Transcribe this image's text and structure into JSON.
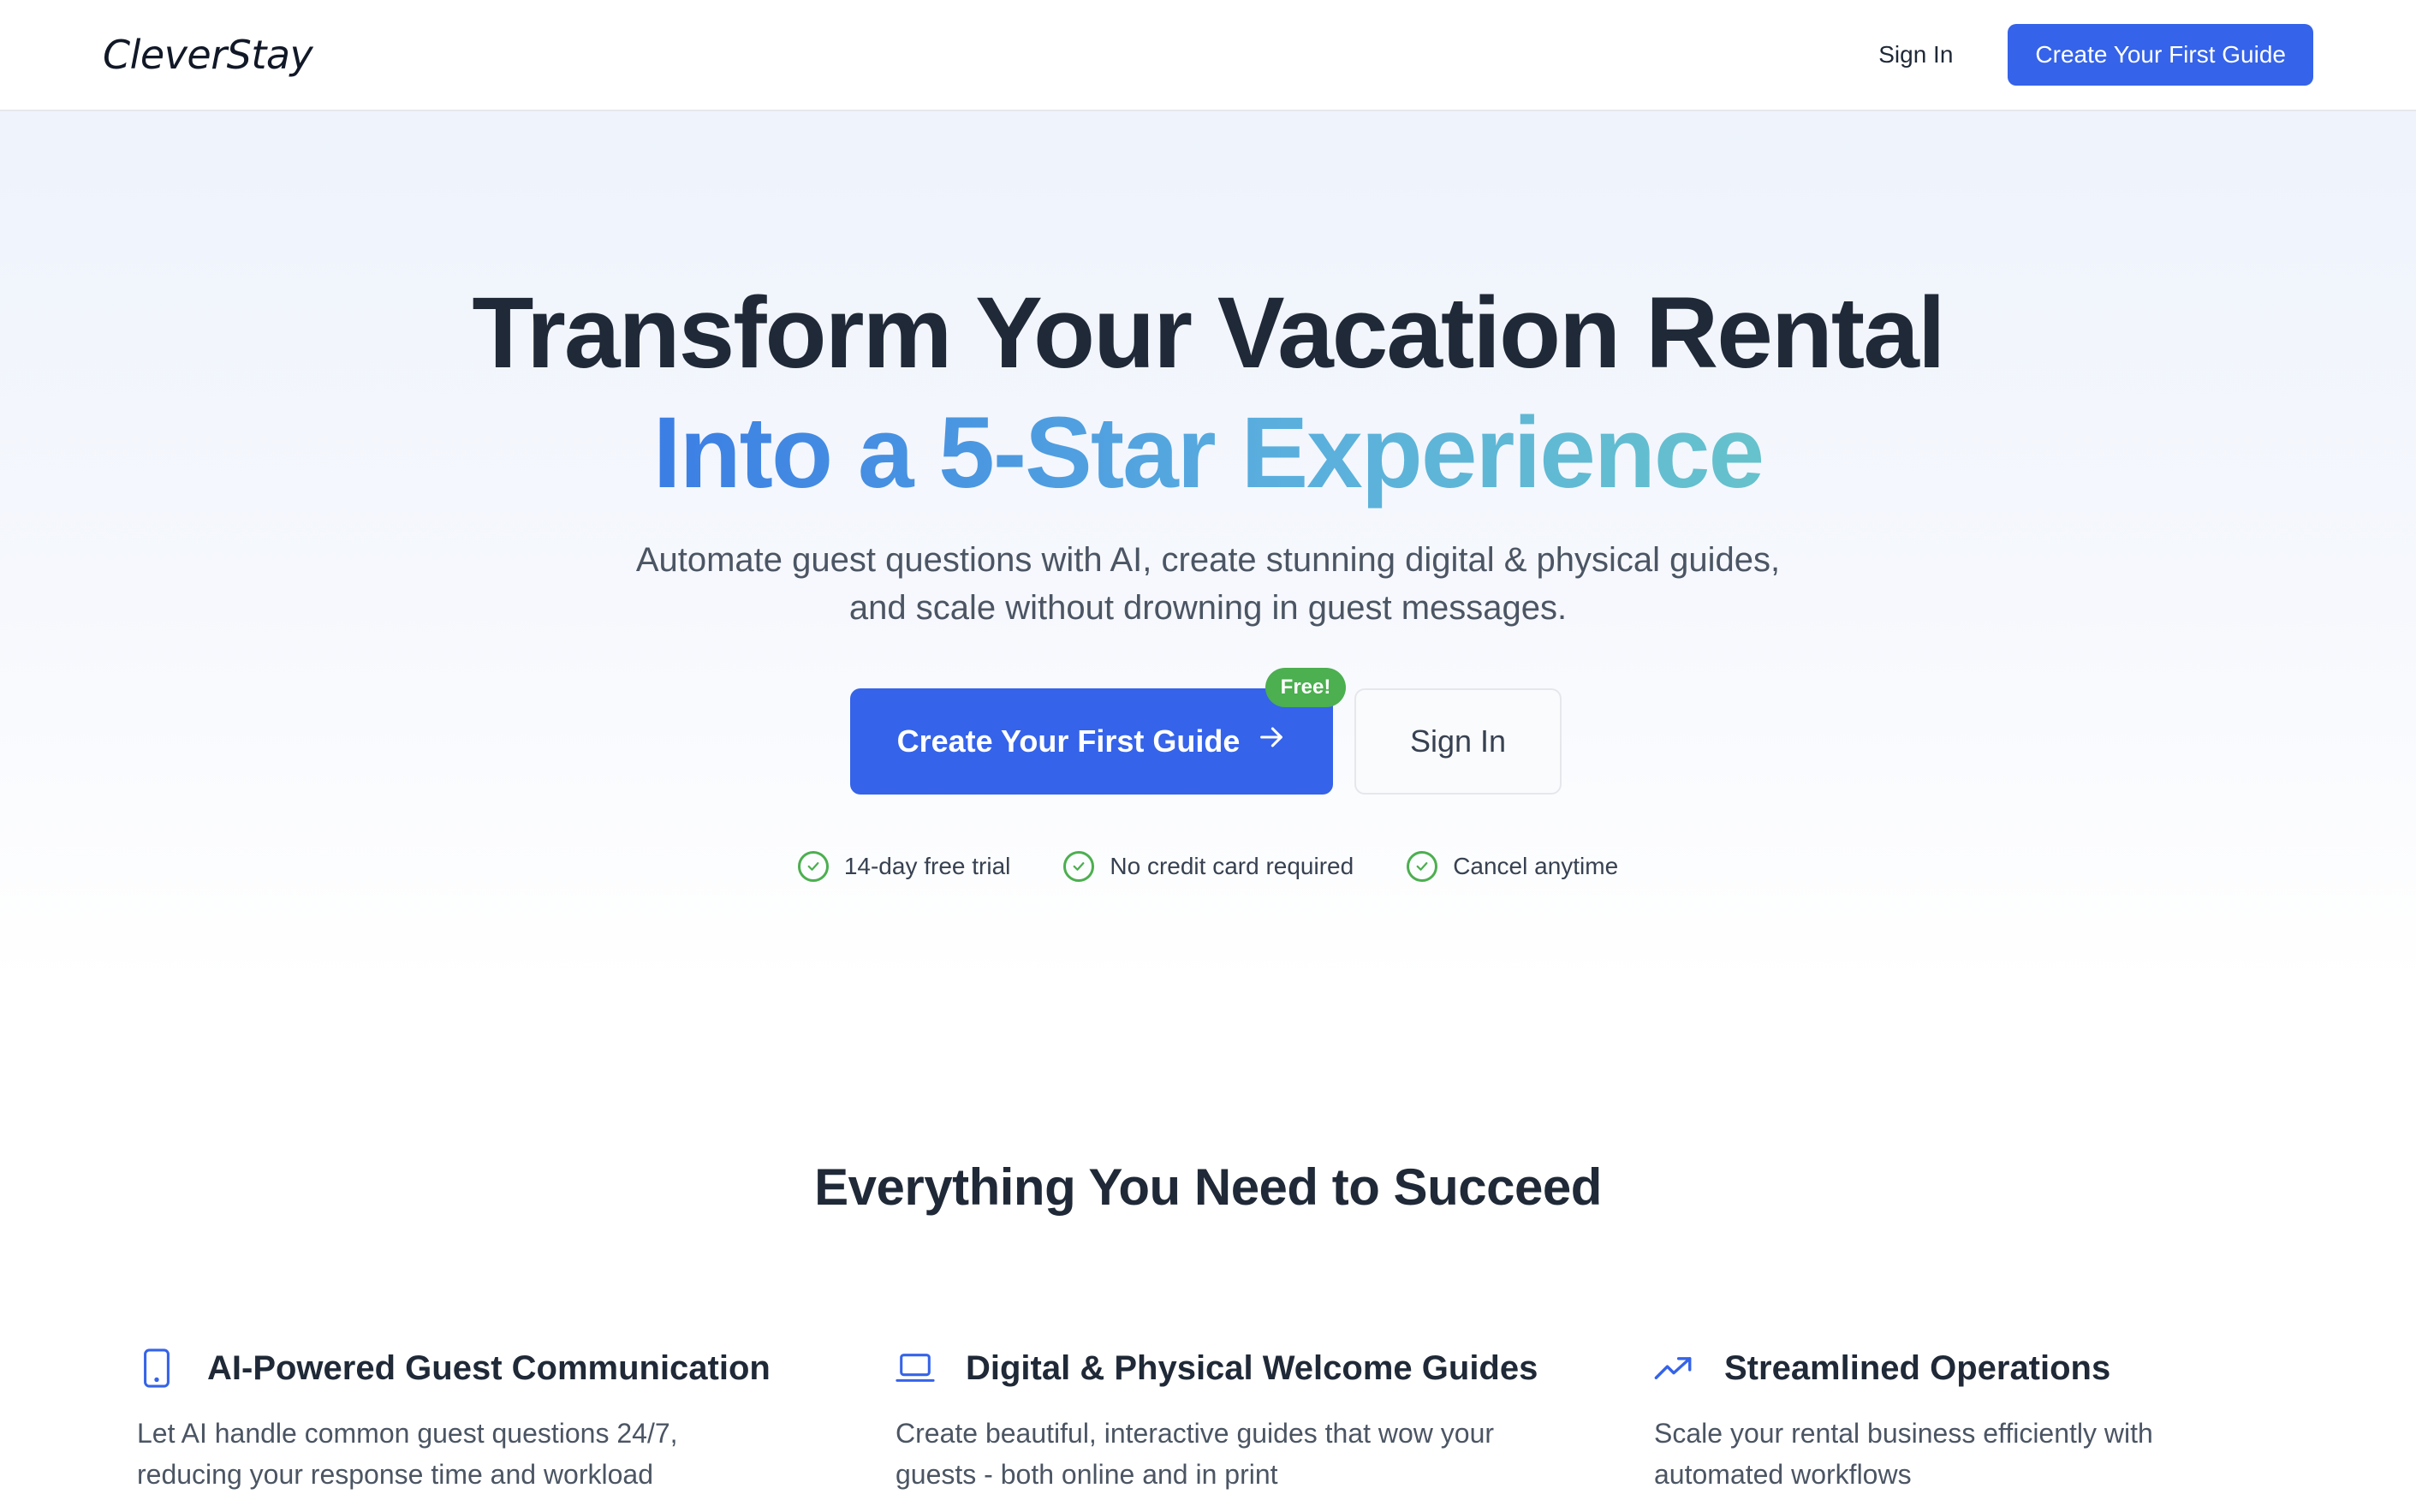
{
  "nav": {
    "logo": "CleverStay",
    "signin_label": "Sign In",
    "cta_label": "Create Your First Guide"
  },
  "hero": {
    "title_line1": "Transform Your Vacation Rental",
    "title_line2": "Into a 5-Star Experience",
    "subtitle_line1": "Automate guest questions with AI, create stunning digital & physical guides,",
    "subtitle_line2": "and scale without drowning in guest messages.",
    "primary_cta": "Create Your First Guide",
    "primary_cta_icon": "arrow-right-icon",
    "badge": "Free!",
    "secondary_cta": "Sign In",
    "checks": [
      {
        "label": "14-day free trial",
        "icon": "check-circle-icon"
      },
      {
        "label": "No credit card required",
        "icon": "check-circle-icon"
      },
      {
        "label": "Cancel anytime",
        "icon": "check-circle-icon"
      }
    ]
  },
  "features": {
    "title": "Everything You Need to Succeed",
    "items": [
      {
        "icon": "phone-icon",
        "title": "AI-Powered Guest Communication",
        "desc_line1": "Let AI handle common guest questions 24/7,",
        "desc_line2": "reducing your response time and workload"
      },
      {
        "icon": "laptop-icon",
        "title": "Digital & Physical Welcome Guides",
        "desc_line1": "Create beautiful, interactive guides that wow your",
        "desc_line2": "guests - both online and in print"
      },
      {
        "icon": "trending-up-icon",
        "title": "Streamlined Operations",
        "desc_line1": "Scale your rental business efficiently with",
        "desc_line2": "automated workflows"
      }
    ]
  },
  "colors": {
    "primary": "#3563e9",
    "badge": "#4caf50",
    "check": "#4caf50",
    "gradient_start": "#3b7ee4",
    "gradient_end": "#66c2cc",
    "heading": "#1f2937"
  }
}
